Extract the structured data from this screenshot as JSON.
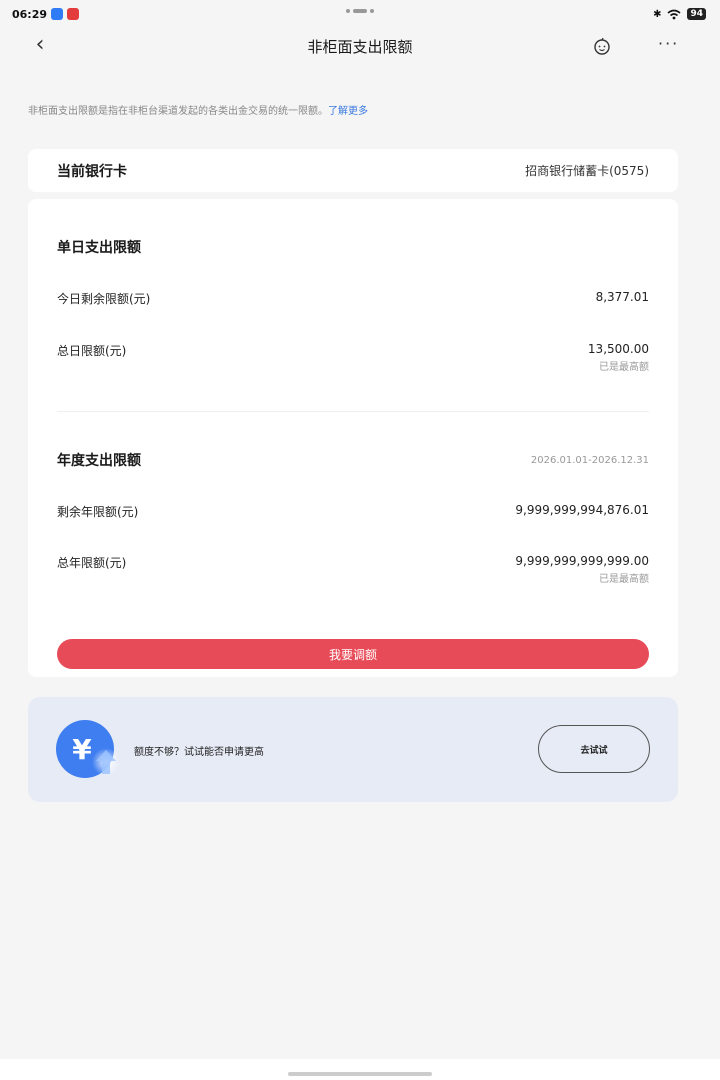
{
  "status_bar": {
    "time": "06:29",
    "battery": "94"
  },
  "header": {
    "back_glyph": "‹",
    "title": "非柜面支出限额",
    "more_glyph": "···"
  },
  "intro": {
    "text": "非柜面支出限额是指在非柜台渠道发起的各类出金交易的统一限额。",
    "link": "了解更多"
  },
  "bank_card": {
    "label": "当前银行卡",
    "value": "招商银行储蓄卡(0575)"
  },
  "daily": {
    "title": "单日支出限额",
    "remaining_label": "今日剩余限额(元)",
    "remaining_value": "8,377.01",
    "total_label": "总日限额(元)",
    "total_value": "13,500.00",
    "total_note": "已是最高额"
  },
  "yearly": {
    "title": "年度支出限额",
    "period": "2026.01.01-2026.12.31",
    "remaining_label": "剩余年限额(元)",
    "remaining_value": "9,999,999,994,876.01",
    "total_label": "总年限额(元)",
    "total_value": "9,999,999,999,999.00",
    "total_note": "已是最高额"
  },
  "adjust_button": "我要调额",
  "promo": {
    "icon_symbol": "¥",
    "text": "额度不够？试试能否申请更高",
    "button": "去试试"
  },
  "colors": {
    "accent_red": "#e84b58",
    "link_blue": "#3a7ae0",
    "promo_bg": "#e6ebf6",
    "icon_blue": "#3f7ef0"
  },
  "icons": [
    "back-chevron-icon",
    "robot-assistant-icon",
    "more-dots-icon",
    "yuan-up-arrow-icon"
  ]
}
